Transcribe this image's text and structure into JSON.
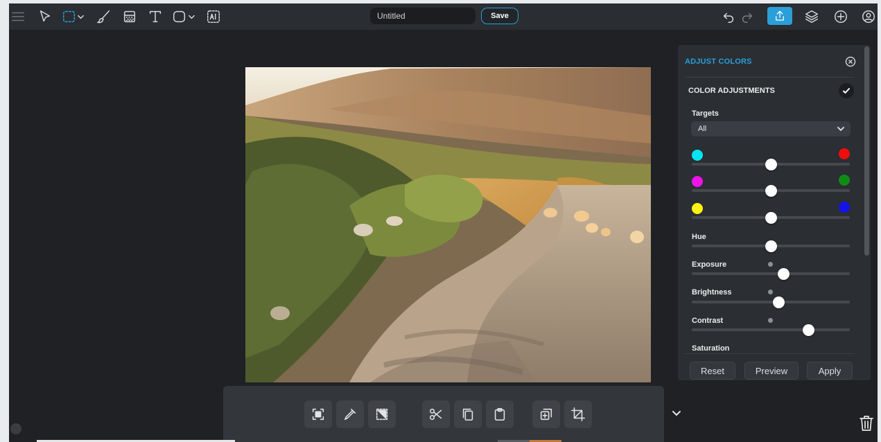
{
  "toolbar": {
    "document_title_placeholder": "Untitled",
    "save_label": "Save"
  },
  "panel": {
    "title": "ADJUST COLORS",
    "section_title": "COLOR ADJUSTMENTS",
    "targets_label": "Targets",
    "targets_value": "All",
    "color_balance": [
      {
        "left_color": "#00e5f0",
        "right_color": "#f00d0d",
        "value": 0.5
      },
      {
        "left_color": "#ee14e6",
        "right_color": "#0f8c16",
        "value": 0.5
      },
      {
        "left_color": "#fbf312",
        "right_color": "#1414e6",
        "value": 0.5
      }
    ],
    "hue": {
      "label": "Hue",
      "value": 0.5
    },
    "exposure": {
      "label": "Exposure",
      "value": 0.58
    },
    "brightness": {
      "label": "Brightness",
      "value": 0.55
    },
    "contrast": {
      "label": "Contrast",
      "value": 0.74
    },
    "saturation": {
      "label": "Saturation"
    },
    "reset_label": "Reset",
    "preview_label": "Preview",
    "apply_label": "Apply"
  },
  "colors": {
    "accent": "#2a9fd8",
    "background": "#1f2124",
    "panel": "#2b2e33"
  }
}
